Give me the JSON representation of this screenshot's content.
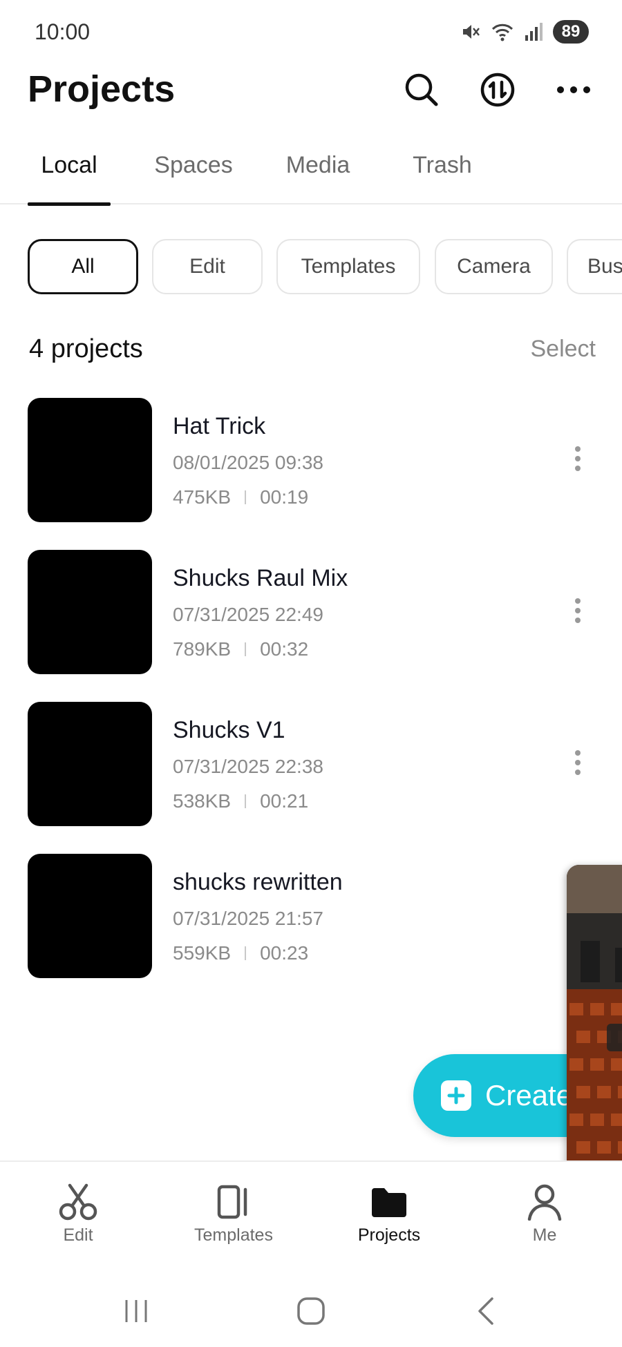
{
  "status_bar": {
    "time": "10:00",
    "battery": "89",
    "icons": [
      "mute-icon",
      "wifi-icon",
      "signal-icon",
      "battery-icon"
    ]
  },
  "header": {
    "title": "Projects",
    "icons": [
      "search-icon",
      "sync-icon",
      "more-icon"
    ]
  },
  "tabs": [
    {
      "label": "Local",
      "active": true
    },
    {
      "label": "Spaces",
      "active": false
    },
    {
      "label": "Media",
      "active": false
    },
    {
      "label": "Trash",
      "active": false
    }
  ],
  "filters": [
    {
      "label": "All",
      "active": true
    },
    {
      "label": "Edit",
      "active": false
    },
    {
      "label": "Templates",
      "active": false
    },
    {
      "label": "Camera",
      "active": false
    },
    {
      "label": "Bus",
      "active": false
    }
  ],
  "list_header": {
    "count": "4 projects",
    "select_label": "Select"
  },
  "projects": [
    {
      "name": "Hat Trick",
      "date": "08/01/2025 09:38",
      "size": "475KB",
      "duration": "00:19"
    },
    {
      "name": "Shucks Raul Mix",
      "date": "07/31/2025 22:49",
      "size": "789KB",
      "duration": "00:32"
    },
    {
      "name": "Shucks V1",
      "date": "07/31/2025 22:38",
      "size": "538KB",
      "duration": "00:21"
    },
    {
      "name": "shucks rewritten",
      "date": "07/31/2025 21:57",
      "size": "559KB",
      "duration": "00:23"
    }
  ],
  "fab": {
    "label": "Create",
    "icon": "plus-icon"
  },
  "bottom_nav": [
    {
      "label": "Edit",
      "icon": "scissors-icon",
      "active": false
    },
    {
      "label": "Templates",
      "icon": "templates-icon",
      "active": false
    },
    {
      "label": "Projects",
      "icon": "folder-icon",
      "active": true
    },
    {
      "label": "Me",
      "icon": "person-icon",
      "active": false
    }
  ],
  "colors": {
    "accent": "#19c4d9",
    "text": "#161823",
    "muted": "#8a8a8a"
  }
}
